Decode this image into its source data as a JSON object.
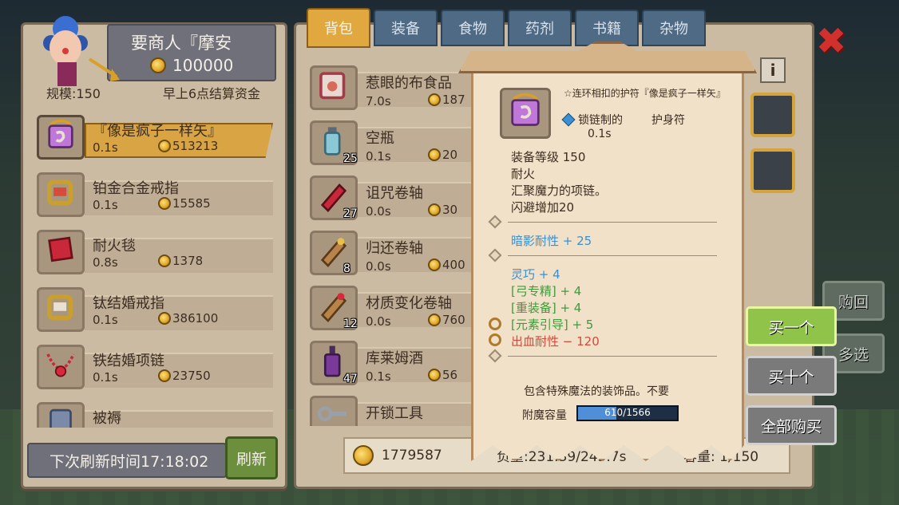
{
  "merchant": {
    "name": "要商人『摩安",
    "gold": "100000",
    "scale": "规模:150",
    "settle": "早上6点结算资金",
    "items": [
      {
        "name": "『像是疯子一样矢』",
        "time": "0.1s",
        "price": "513213"
      },
      {
        "name": "铂金合金戒指",
        "time": "0.1s",
        "price": "15585"
      },
      {
        "name": "耐火毯",
        "time": "0.8s",
        "price": "1378"
      },
      {
        "name": "钛结婚戒指",
        "time": "0.1s",
        "price": "386100"
      },
      {
        "name": "铁结婚项链",
        "time": "0.1s",
        "price": "23750"
      },
      {
        "name": "被褥",
        "time": "",
        "price": ""
      }
    ],
    "refresh_time": "下次刷新时间17:18:02",
    "refresh_label": "刷新"
  },
  "tabs": [
    "背包",
    "装备",
    "食物",
    "药剂",
    "书籍",
    "杂物"
  ],
  "bag": {
    "items": [
      {
        "name": "惹眼的布食品",
        "time": "7.0s",
        "price": "187",
        "count": ""
      },
      {
        "name": "空瓶",
        "time": "0.1s",
        "price": "20",
        "count": "25"
      },
      {
        "name": "诅咒卷轴",
        "time": "0.0s",
        "price": "30",
        "count": "27"
      },
      {
        "name": "归还卷轴",
        "time": "0.0s",
        "price": "400",
        "count": "8"
      },
      {
        "name": "材质变化卷轴",
        "time": "0.0s",
        "price": "760",
        "count": "12"
      },
      {
        "name": "库莱姆酒",
        "time": "0.1s",
        "price": "56",
        "count": "47"
      },
      {
        "name": "开锁工具",
        "time": "",
        "price": "",
        "count": ""
      }
    ],
    "gold": "1779587",
    "weight": "负重:231.39/245.7s",
    "capacity": "容量: 1/150"
  },
  "tooltip": {
    "title": "☆连环相扣的护符『像是疯子一样矢』",
    "material": "锁链制的",
    "type": "护身符",
    "time": "0.1s",
    "lines": [
      "装备等级 150",
      "耐火",
      "汇聚魔力的项链。",
      "闪避增加20"
    ],
    "shadow_res": "暗影耐性 + 25",
    "agility": "灵巧 + 4",
    "bow_master": "[弓专精] + 4",
    "heavy_armor": "[重装备] + 4",
    "element_guide": "[元素引导] + 5",
    "bleed_res": "出血耐性 − 120",
    "description": "包含特殊魔法的装饰品。不要",
    "enchant_label": "附魔容量",
    "enchant_value": "610/1566",
    "enchant_ratio": 0.389
  },
  "buttons": {
    "buy_back": "购回",
    "multi_select": "多选",
    "buy_one": "买一个",
    "buy_ten": "买十个",
    "buy_all": "全部购买",
    "info": "i",
    "close": "✖"
  }
}
